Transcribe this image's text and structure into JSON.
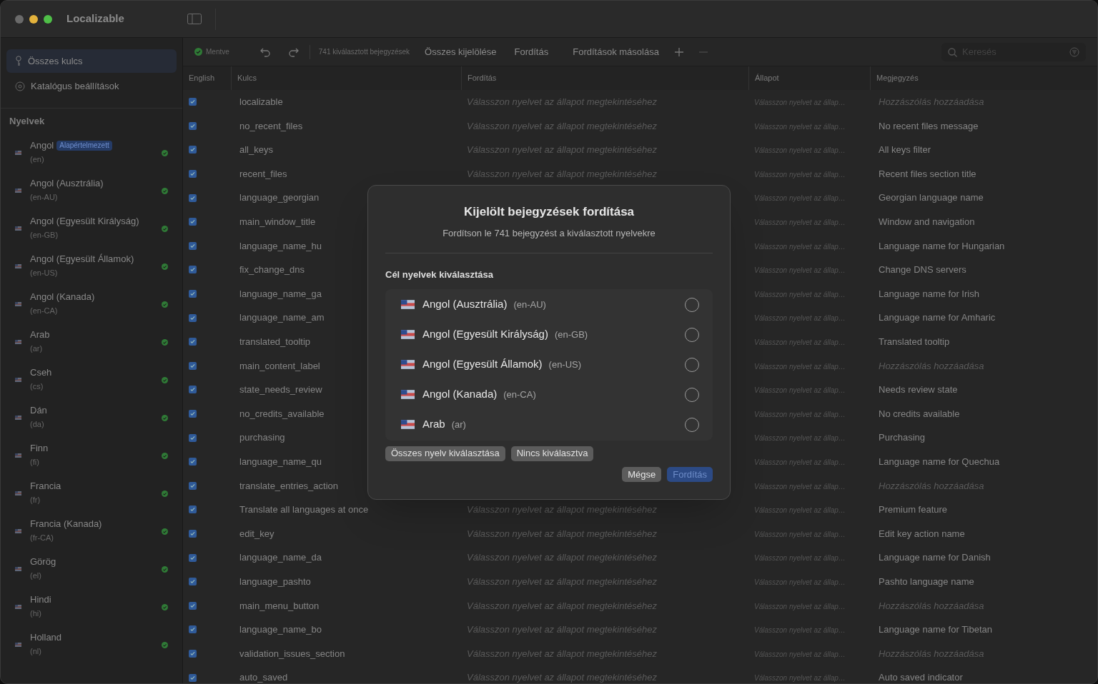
{
  "window": {
    "title": "Localizable"
  },
  "sidebar": {
    "items": [
      {
        "label": "Összes kulcs",
        "selected": true,
        "kind": "key"
      },
      {
        "label": "Katalógus beállítások",
        "selected": false,
        "kind": "gear"
      }
    ],
    "languages_title": "Nyelvek",
    "languages": [
      {
        "name": "Angol",
        "code": "(en)",
        "badge": "Alapértelmezett",
        "done": true
      },
      {
        "name": "Angol (Ausztrália)",
        "code": "(en-AU)",
        "done": true
      },
      {
        "name": "Angol (Egyesült Királyság)",
        "code": "(en-GB)",
        "done": true
      },
      {
        "name": "Angol (Egyesült Államok)",
        "code": "(en-US)",
        "done": true
      },
      {
        "name": "Angol (Kanada)",
        "code": "(en-CA)",
        "done": true
      },
      {
        "name": "Arab",
        "code": "(ar)",
        "done": true
      },
      {
        "name": "Cseh",
        "code": "(cs)",
        "done": true
      },
      {
        "name": "Dán",
        "code": "(da)",
        "done": true
      },
      {
        "name": "Finn",
        "code": "(fi)",
        "done": true
      },
      {
        "name": "Francia",
        "code": "(fr)",
        "done": true
      },
      {
        "name": "Francia (Kanada)",
        "code": "(fr-CA)",
        "done": true
      },
      {
        "name": "Görög",
        "code": "(el)",
        "done": true
      },
      {
        "name": "Hindi",
        "code": "(hi)",
        "done": true
      },
      {
        "name": "Holland",
        "code": "(nl)",
        "done": true
      }
    ]
  },
  "toolbar": {
    "status": "Mentve",
    "selection": "741 kiválasztott bejegyzések",
    "actions": [
      "Összes kijelölése",
      "Fordítás",
      "Fordítások másolása"
    ],
    "search": {
      "placeholder": "Keresés"
    }
  },
  "table": {
    "columns": [
      "English",
      "Kulcs",
      "Fordítás",
      "Állapot",
      "Megjegyzés"
    ],
    "rows": [
      {
        "checked": true,
        "key": "localizable",
        "translation": "Válasszon nyelvet az állapot megtekintéséhez",
        "status": "Válasszon nyelvet az állap…",
        "comment": "Hozzászólás hozzáadása",
        "comment_muted": true
      },
      {
        "checked": true,
        "key": "no_recent_files",
        "translation": "Válasszon nyelvet az állapot megtekintéséhez",
        "status": "Válasszon nyelvet az állap…",
        "comment": "No recent files message",
        "comment_muted": false
      },
      {
        "checked": true,
        "key": "all_keys",
        "translation": "Válasszon nyelvet az állapot megtekintéséhez",
        "status": "Válasszon nyelvet az állap…",
        "comment": "All keys filter",
        "comment_muted": false
      },
      {
        "checked": true,
        "key": "recent_files",
        "translation": "Válasszon nyelvet az állapot megtekintéséhez",
        "status": "Válasszon nyelvet az állap…",
        "comment": "Recent files section title",
        "comment_muted": false
      },
      {
        "checked": true,
        "key": "language_georgian",
        "status": "Válasszon nyelvet az állap…",
        "comment": "Georgian language name",
        "comment_muted": false
      },
      {
        "checked": true,
        "key": "main_window_title",
        "status": "Válasszon nyelvet az állap…",
        "comment": "Window and navigation",
        "comment_muted": false
      },
      {
        "checked": true,
        "key": "language_name_hu",
        "status": "Válasszon nyelvet az állap…",
        "comment": "Language name for Hungarian",
        "comment_muted": false
      },
      {
        "checked": true,
        "key": "fix_change_dns",
        "status": "Válasszon nyelvet az állap…",
        "comment": "Change DNS servers",
        "comment_muted": false
      },
      {
        "checked": true,
        "key": "language_name_ga",
        "status": "Válasszon nyelvet az állap…",
        "comment": "Language name for Irish",
        "comment_muted": false
      },
      {
        "checked": true,
        "key": "language_name_am",
        "status": "Válasszon nyelvet az állap…",
        "comment": "Language name for Amharic",
        "comment_muted": false
      },
      {
        "checked": true,
        "key": "translated_tooltip",
        "status": "Válasszon nyelvet az állap…",
        "comment": "Translated tooltip",
        "comment_muted": false
      },
      {
        "checked": true,
        "key": "main_content_label",
        "status": "Válasszon nyelvet az állap…",
        "comment": "Hozzászólás hozzáadása",
        "comment_muted": true
      },
      {
        "checked": true,
        "key": "state_needs_review",
        "status": "Válasszon nyelvet az állap…",
        "comment": "Needs review state",
        "comment_muted": false
      },
      {
        "checked": true,
        "key": "no_credits_available",
        "status": "Válasszon nyelvet az állap…",
        "comment": "No credits available",
        "comment_muted": false
      },
      {
        "checked": true,
        "key": "purchasing",
        "status": "Válasszon nyelvet az állap…",
        "comment": "Purchasing",
        "comment_muted": false
      },
      {
        "checked": true,
        "key": "language_name_qu",
        "status": "Válasszon nyelvet az állap…",
        "comment": "Language name for Quechua",
        "comment_muted": false
      },
      {
        "checked": true,
        "key": "translate_entries_action",
        "status": "Válasszon nyelvet az állap…",
        "comment": "Hozzászólás hozzáadása",
        "comment_muted": true
      },
      {
        "checked": true,
        "key": "Translate all languages at once",
        "translation": "Válasszon nyelvet az állapot megtekintéséhez",
        "status": "Válasszon nyelvet az állap…",
        "comment": "Premium feature",
        "comment_muted": false
      },
      {
        "checked": true,
        "key": "edit_key",
        "translation": "Válasszon nyelvet az állapot megtekintéséhez",
        "status": "Válasszon nyelvet az állap…",
        "comment": "Edit key action name",
        "comment_muted": false
      },
      {
        "checked": true,
        "key": "language_name_da",
        "translation": "Válasszon nyelvet az állapot megtekintéséhez",
        "status": "Válasszon nyelvet az állap…",
        "comment": "Language name for Danish",
        "comment_muted": false
      },
      {
        "checked": true,
        "key": "language_pashto",
        "translation": "Válasszon nyelvet az állapot megtekintéséhez",
        "status": "Válasszon nyelvet az állap…",
        "comment": "Pashto language name",
        "comment_muted": false
      },
      {
        "checked": true,
        "key": "main_menu_button",
        "translation": "Válasszon nyelvet az állapot megtekintéséhez",
        "status": "Válasszon nyelvet az állap…",
        "comment": "Hozzászólás hozzáadása",
        "comment_muted": true
      },
      {
        "checked": true,
        "key": "language_name_bo",
        "translation": "Válasszon nyelvet az állapot megtekintéséhez",
        "status": "Válasszon nyelvet az állap…",
        "comment": "Language name for Tibetan",
        "comment_muted": false
      },
      {
        "checked": true,
        "key": "validation_issues_section",
        "translation": "Válasszon nyelvet az állapot megtekintéséhez",
        "status": "Válasszon nyelvet az állap…",
        "comment": "Hozzászólás hozzáadása",
        "comment_muted": true
      },
      {
        "checked": true,
        "key": "auto_saved",
        "translation": "Válasszon nyelvet az állapot megtekintéséhez",
        "status": "Válasszon nyelvet az állap…",
        "comment": "Auto saved indicator",
        "comment_muted": false
      }
    ]
  },
  "dialog": {
    "title": "Kijelölt bejegyzések fordítása",
    "subtitle": "Fordítson le 741 bejegyzést a kiválasztott nyelvekre",
    "section": "Cél nyelvek kiválasztása",
    "languages": [
      {
        "name": "Angol (Ausztrália)",
        "code": "(en-AU)",
        "selected": false
      },
      {
        "name": "Angol (Egyesült Királyság)",
        "code": "(en-GB)",
        "selected": false
      },
      {
        "name": "Angol (Egyesült Államok)",
        "code": "(en-US)",
        "selected": false
      },
      {
        "name": "Angol (Kanada)",
        "code": "(en-CA)",
        "selected": false
      },
      {
        "name": "Arab",
        "code": "(ar)",
        "selected": false
      }
    ],
    "select_buttons": [
      "Összes nyelv kiválasztása",
      "Nincs kiválasztva"
    ],
    "cancel": "Mégse",
    "confirm": {
      "label": "Fordítás",
      "disabled": true
    }
  }
}
